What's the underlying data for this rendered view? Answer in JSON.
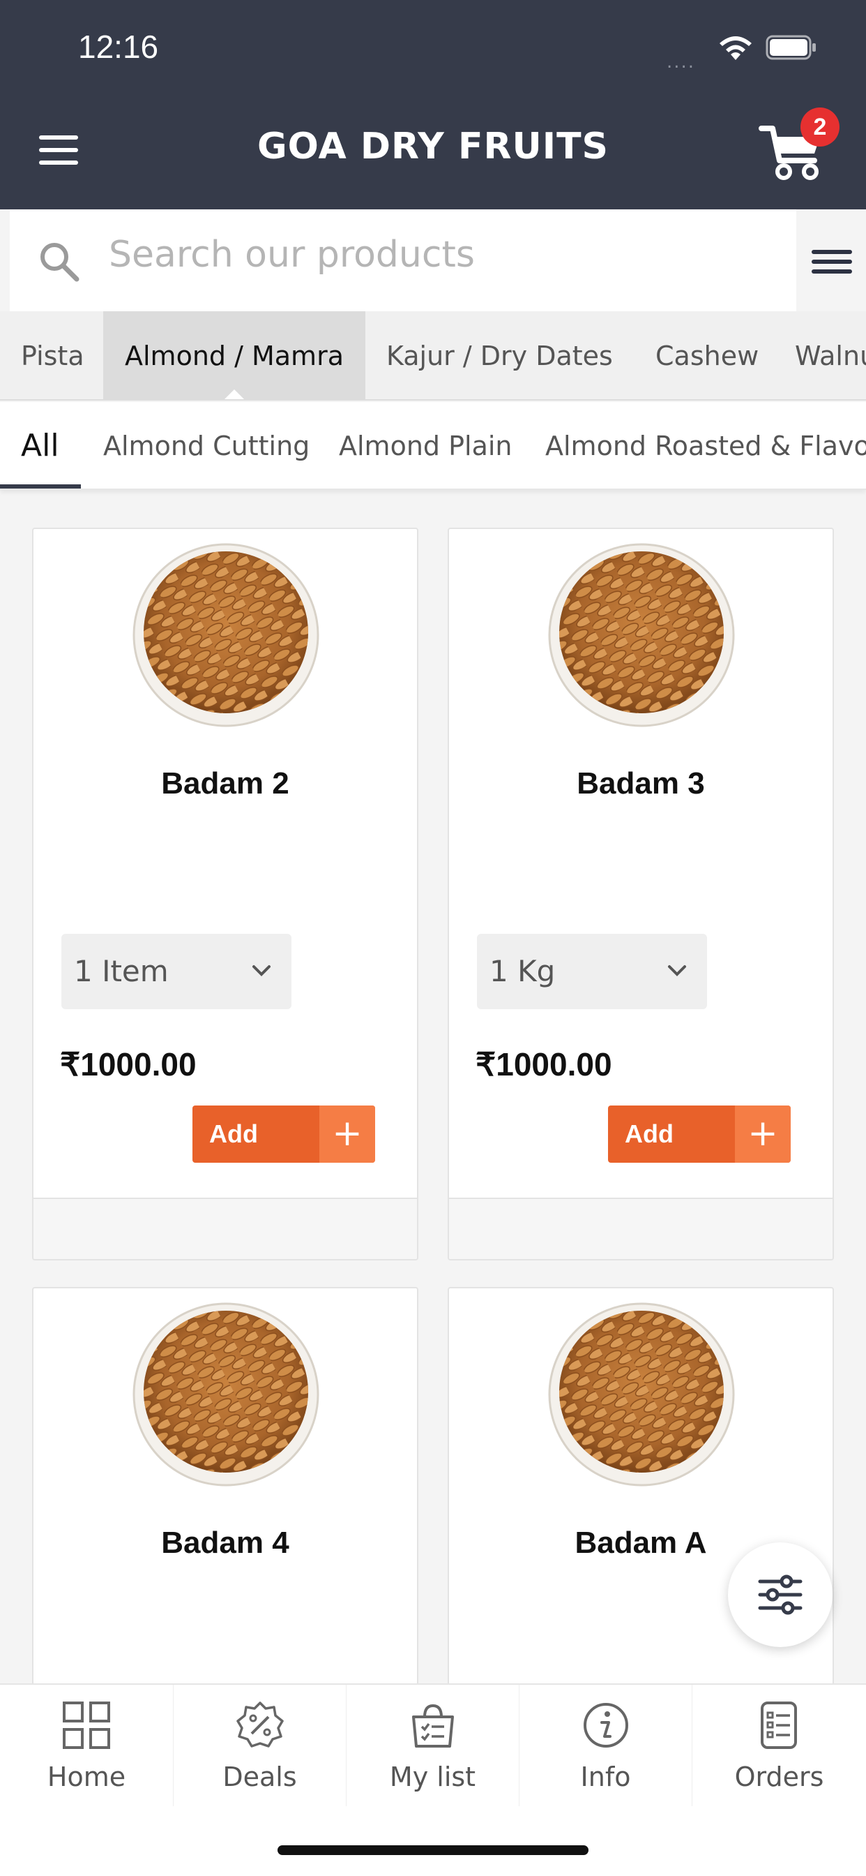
{
  "status_bar": {
    "time": "12:16",
    "signal": "...."
  },
  "header": {
    "title": "GOA DRY FRUITS",
    "cart_count": "2"
  },
  "search": {
    "placeholder": "Search our products"
  },
  "categories": [
    "Pista",
    "Almond / Mamra",
    "Kajur / Dry Dates",
    "Cashew",
    "Walnu"
  ],
  "active_category": "Almond / Mamra",
  "subcategories": [
    "All",
    "Almond Cutting",
    "Almond Plain",
    "Almond Roasted & Flavou"
  ],
  "active_subcategory": "All",
  "products": [
    {
      "name": "Badam 2",
      "variant": "1 Item",
      "price": "₹1000.00",
      "add_label": "Add",
      "plus": "+"
    },
    {
      "name": "Badam 3",
      "variant": "1 Kg",
      "price": "₹1000.00",
      "add_label": "Add",
      "plus": "+"
    },
    {
      "name": "Badam 4"
    },
    {
      "name": "Badam A"
    }
  ],
  "bottom_nav": [
    {
      "label": "Home",
      "icon": "grid-icon"
    },
    {
      "label": "Deals",
      "icon": "percent-badge-icon"
    },
    {
      "label": "My list",
      "icon": "shopping-list-bag-icon"
    },
    {
      "label": "Info",
      "icon": "info-icon"
    },
    {
      "label": "Orders",
      "icon": "orders-list-icon"
    }
  ],
  "colors": {
    "header": "#363b4a",
    "accent": "#e8612a",
    "accent_light": "#f57d45",
    "badge": "#e63030"
  }
}
